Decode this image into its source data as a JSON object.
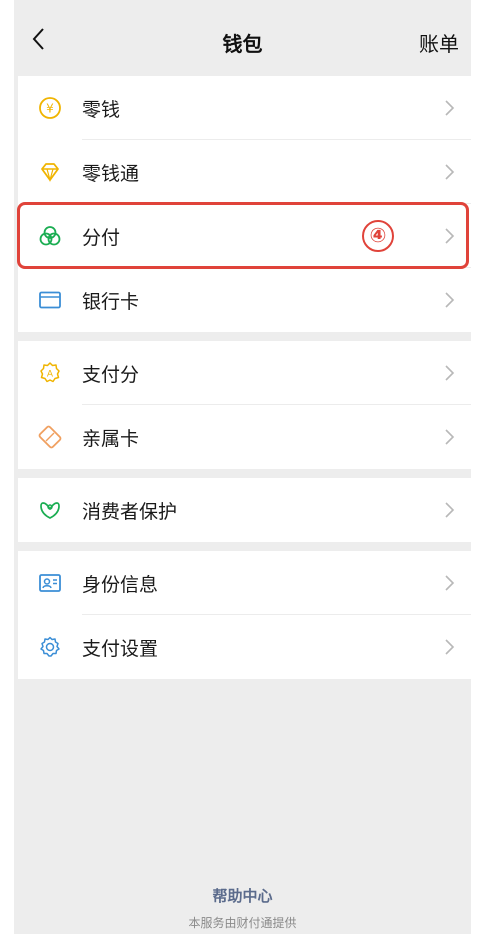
{
  "nav": {
    "title": "钱包",
    "right": "账单"
  },
  "groups": [
    {
      "items": [
        {
          "label": "零钱",
          "icon": "coin-yen-icon"
        },
        {
          "label": "零钱通",
          "icon": "diamond-icon"
        },
        {
          "label": "分付",
          "icon": "fenfu-icon"
        },
        {
          "label": "银行卡",
          "icon": "bank-card-icon"
        }
      ]
    },
    {
      "items": [
        {
          "label": "支付分",
          "icon": "payscore-icon"
        },
        {
          "label": "亲属卡",
          "icon": "family-card-icon"
        }
      ]
    },
    {
      "items": [
        {
          "label": "消费者保护",
          "icon": "consumer-protection-icon"
        }
      ]
    },
    {
      "items": [
        {
          "label": "身份信息",
          "icon": "id-card-icon"
        },
        {
          "label": "支付设置",
          "icon": "gear-icon"
        }
      ]
    }
  ],
  "annotation": {
    "badge": "④",
    "color": "#e0433a"
  },
  "footer": {
    "help": "帮助中心",
    "note": "本服务由财付通提供"
  },
  "colors": {
    "yellow": "#f0b400",
    "green": "#1aad52",
    "blue": "#3b8ed6",
    "red": "#e0433a"
  }
}
